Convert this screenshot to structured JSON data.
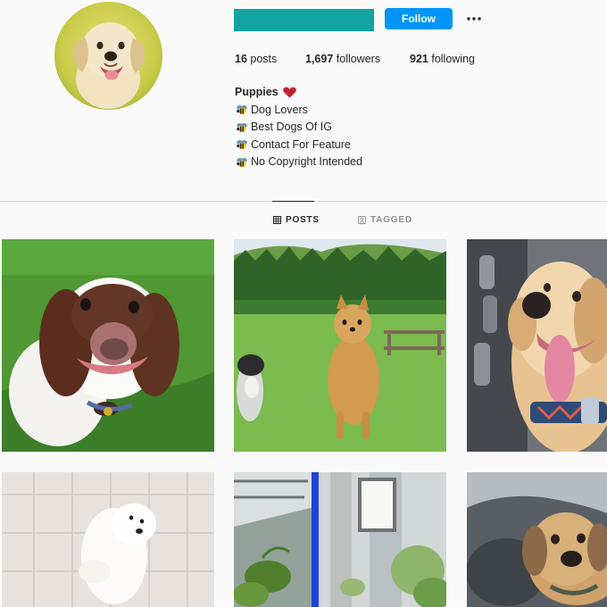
{
  "profile": {
    "avatar_icon": "golden-puppy-avatar-icon",
    "username_bar_color": "#13a3a0",
    "follow_label": "Follow",
    "more_icon": "more-options-icon",
    "stats": {
      "posts": "16",
      "posts_label": "posts",
      "followers": "1,697",
      "followers_label": "followers",
      "following": "921",
      "following_label": "following"
    },
    "bio": {
      "name": "Puppies",
      "name_icon": "heart-icon",
      "lines": [
        "Dog Lovers",
        "Best Dogs Of IG",
        "Contact For Feature",
        "No Copyright Intended"
      ],
      "line_icon": "bee-icon"
    }
  },
  "tabs": [
    {
      "label": "POSTS",
      "icon": "grid-icon",
      "active": true
    },
    {
      "label": "TAGGED",
      "icon": "tagged-icon",
      "active": false
    }
  ],
  "posts": [
    {
      "icon": "springer-spaniel-photo-icon"
    },
    {
      "icon": "pomeranian-standing-photo-icon"
    },
    {
      "icon": "golden-retriever-smile-photo-icon"
    },
    {
      "icon": "white-pomeranian-photo-icon"
    },
    {
      "icon": "plant-room-photo-icon"
    },
    {
      "icon": "terrier-puppy-photo-icon"
    }
  ],
  "colors": {
    "accent": "#0095f6",
    "text": "#262626",
    "muted": "#8e8e8e",
    "divider": "#dbdbdb",
    "background": "#fafafa"
  }
}
